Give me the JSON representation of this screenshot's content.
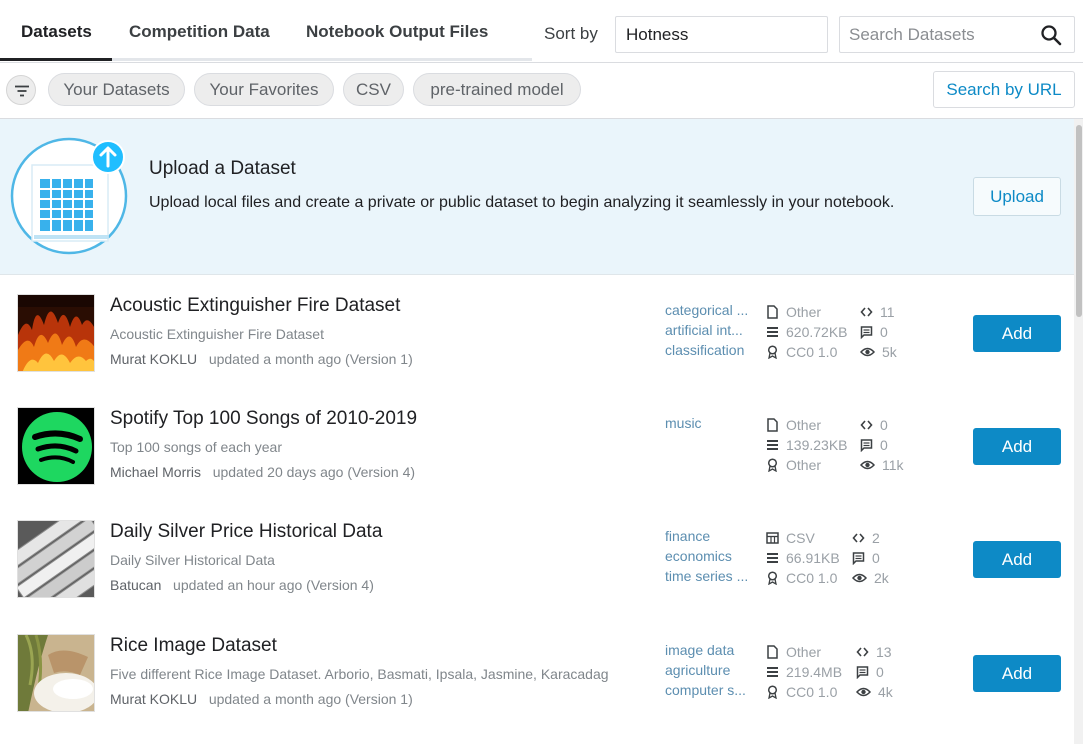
{
  "colors": {
    "accent": "#0d8ac6",
    "tag": "#5c8eb0",
    "panel": "#eaf5fb"
  },
  "tabs": [
    {
      "label": "Datasets",
      "active": true
    },
    {
      "label": "Competition Data",
      "active": false
    },
    {
      "label": "Notebook Output Files",
      "active": false
    }
  ],
  "sort": {
    "label": "Sort by",
    "value": "Hotness"
  },
  "search": {
    "placeholder": "Search Datasets",
    "icon": "search-icon"
  },
  "filters": {
    "icon": "filter-icon",
    "chips": [
      "Your Datasets",
      "Your Favorites",
      "CSV",
      "pre-trained model"
    ],
    "search_url_label": "Search by URL"
  },
  "upload": {
    "title": "Upload a Dataset",
    "description": "Upload local files and create a private or public dataset to begin analyzing it seamlessly in your notebook.",
    "button_label": "Upload"
  },
  "datasets": [
    {
      "title": "Acoustic Extinguisher Fire Dataset",
      "subtitle": "Acoustic Extinguisher Fire Dataset",
      "author": "Murat KOKLU",
      "updated": "updated a month ago (Version 1)",
      "tags": [
        "categorical ...",
        "artificial int...",
        "classification"
      ],
      "type": "Other",
      "type_icon": "file-icon",
      "size": "620.72KB",
      "license": "CC0 1.0",
      "code": "11",
      "discussions": "0",
      "views": "5k",
      "add_label": "Add",
      "thumb": "fire"
    },
    {
      "title": "Spotify Top 100 Songs of 2010-2019",
      "subtitle": "Top 100 songs of each year",
      "author": "Michael Morris",
      "updated": "updated 20 days ago (Version 4)",
      "tags": [
        "music"
      ],
      "type": "Other",
      "type_icon": "file-icon",
      "size": "139.23KB",
      "license": "Other",
      "code": "0",
      "discussions": "0",
      "views": "11k",
      "add_label": "Add",
      "thumb": "spotify"
    },
    {
      "title": "Daily Silver Price Historical Data",
      "subtitle": "Daily Silver Historical Data",
      "author": "Batucan",
      "updated": "updated an hour ago (Version 4)",
      "tags": [
        "finance",
        "economics",
        "time series ..."
      ],
      "type": "CSV",
      "type_icon": "table-icon",
      "size": "66.91KB",
      "license": "CC0 1.0",
      "code": "2",
      "discussions": "0",
      "views": "2k",
      "add_label": "Add",
      "thumb": "silver"
    },
    {
      "title": "Rice Image Dataset",
      "subtitle": "Five different Rice Image Dataset. Arborio, Basmati, Ipsala, Jasmine, Karacadag",
      "author": "Murat KOKLU",
      "updated": "updated a month ago (Version 1)",
      "tags": [
        "image data",
        "agriculture",
        "computer s..."
      ],
      "type": "Other",
      "type_icon": "file-icon",
      "size": "219.4MB",
      "license": "CC0 1.0",
      "code": "13",
      "discussions": "0",
      "views": "4k",
      "add_label": "Add",
      "thumb": "rice"
    }
  ]
}
